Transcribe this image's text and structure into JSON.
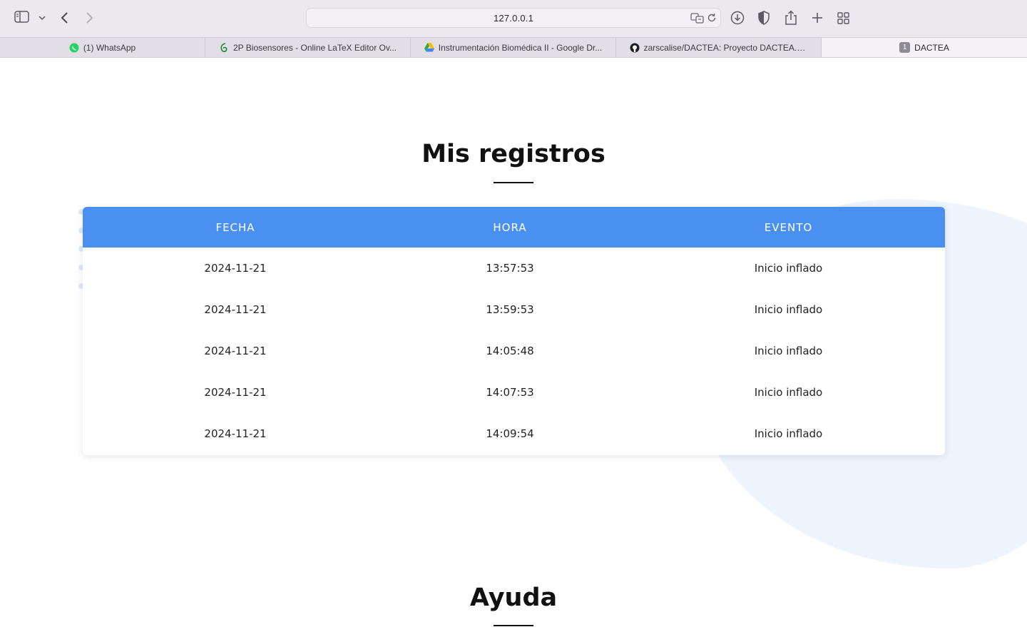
{
  "browser": {
    "url": "127.0.0.1",
    "tabs": [
      {
        "label": "(1) WhatsApp",
        "icon": "whatsapp-icon",
        "active": false
      },
      {
        "label": "2P Biosensores - Online LaTeX Editor Ov...",
        "icon": "overleaf-icon",
        "active": false
      },
      {
        "label": "Instrumentación Biomédica II - Google Dr...",
        "icon": "google-drive-icon",
        "active": false
      },
      {
        "label": "zarscalise/DACTEA: Proyecto DACTEA. W...",
        "icon": "github-icon",
        "active": false
      },
      {
        "label": "DACTEA",
        "badge": "1",
        "active": true
      }
    ]
  },
  "registros": {
    "title": "Mis registros",
    "columns": [
      "FECHA",
      "HORA",
      "EVENTO"
    ],
    "rows": [
      {
        "fecha": "2024-11-21",
        "hora": "13:57:53",
        "evento": "Inicio inflado"
      },
      {
        "fecha": "2024-11-21",
        "hora": "13:59:53",
        "evento": "Inicio inflado"
      },
      {
        "fecha": "2024-11-21",
        "hora": "14:05:48",
        "evento": "Inicio inflado"
      },
      {
        "fecha": "2024-11-21",
        "hora": "14:07:53",
        "evento": "Inicio inflado"
      },
      {
        "fecha": "2024-11-21",
        "hora": "14:09:54",
        "evento": "Inicio inflado"
      }
    ]
  },
  "ayuda": {
    "title": "Ayuda"
  },
  "colors": {
    "table_header": "#4a90f0",
    "background_blob": "#eef4fd"
  }
}
